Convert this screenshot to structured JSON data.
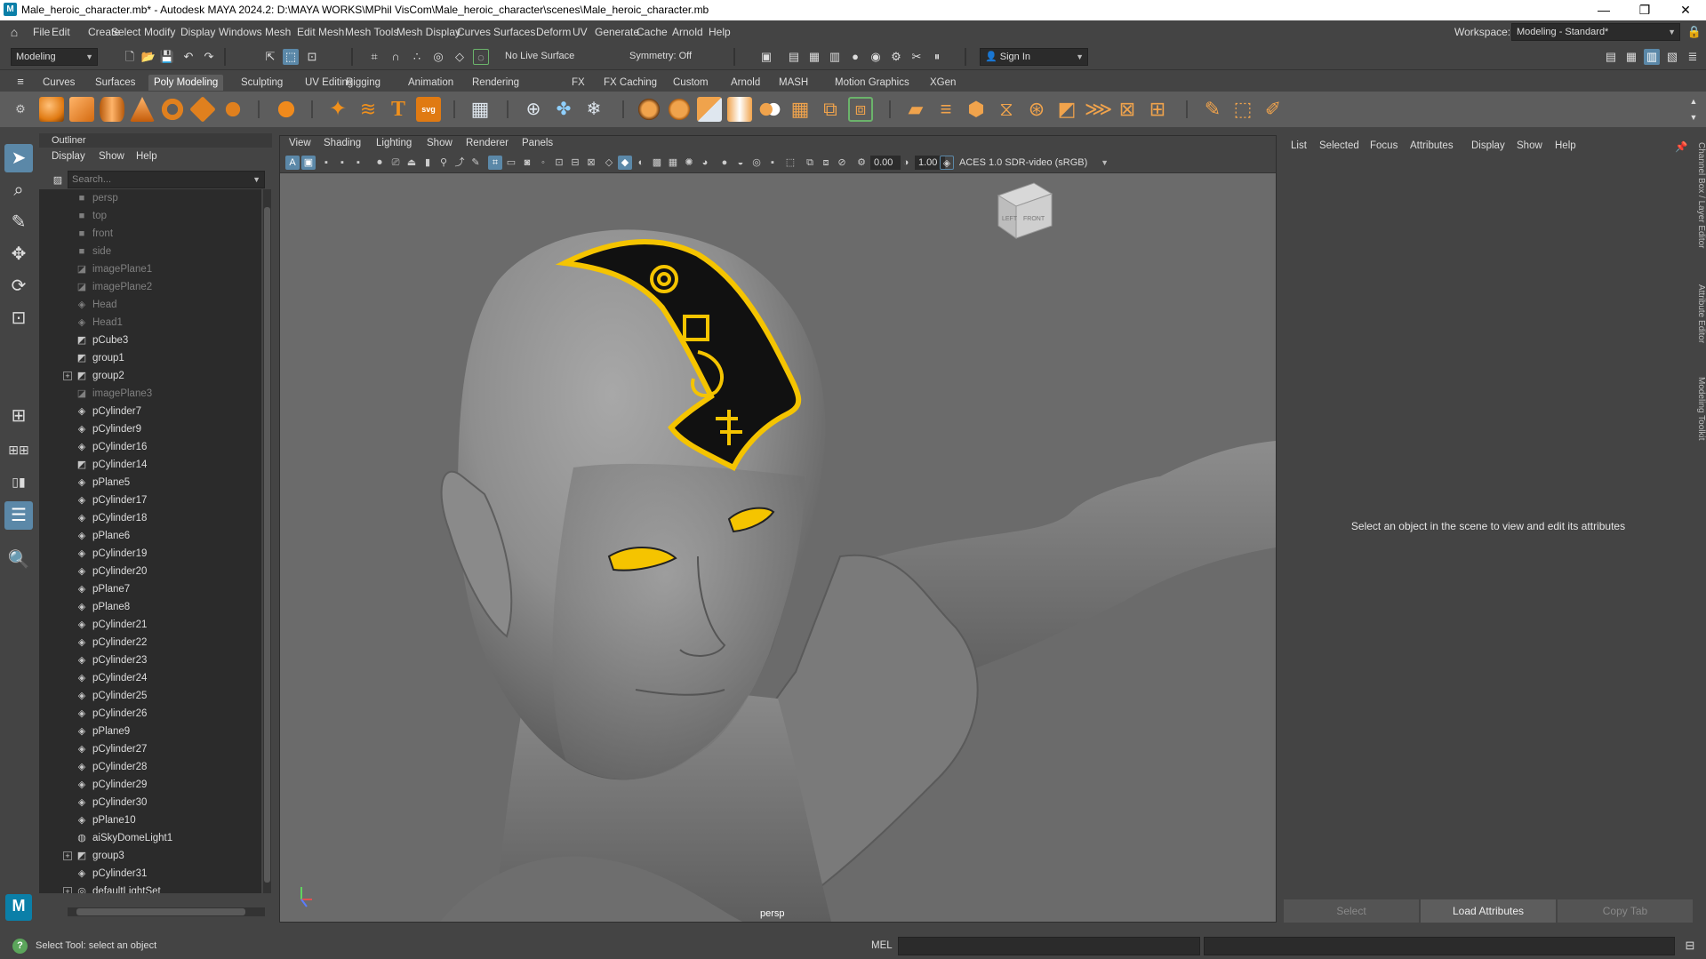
{
  "window": {
    "title": "Male_heroic_character.mb* - Autodesk MAYA 2024.2: D:\\MAYA WORKS\\MPhil VisCom\\Male_heroic_character\\scenes\\Male_heroic_character.mb",
    "app_icon": "M",
    "minimize": "—",
    "maximize": "❐",
    "close": "✕"
  },
  "menubar": {
    "items": [
      "File",
      "Edit",
      "Create",
      "Select",
      "Modify",
      "Display",
      "Windows",
      "Mesh",
      "Edit Mesh",
      "Mesh Tools",
      "Mesh Display",
      "Curves",
      "Surfaces",
      "Deform",
      "UV",
      "Generate",
      "Cache",
      "Arnold",
      "Help"
    ],
    "workspace_label": "Workspace:",
    "workspace_value": "Modeling - Standard*"
  },
  "statusline": {
    "mode": "Modeling",
    "live_surface": "No Live Surface",
    "symmetry": "Symmetry: Off",
    "sign_in": "Sign In"
  },
  "shelf": {
    "tabs": [
      "Curves",
      "Surfaces",
      "Poly Modeling",
      "Sculpting",
      "UV Editing",
      "Rigging",
      "Animation",
      "Rendering",
      "FX",
      "FX Caching",
      "Custom",
      "Arnold",
      "MASH",
      "Motion Graphics",
      "XGen"
    ],
    "active_tab": "Poly Modeling"
  },
  "outliner": {
    "title": "Outliner",
    "menu": [
      "Display",
      "Show",
      "Help"
    ],
    "search_placeholder": "Search...",
    "items": [
      {
        "label": "persp",
        "icon": "camera-icon",
        "dim": true
      },
      {
        "label": "top",
        "icon": "camera-icon",
        "dim": true
      },
      {
        "label": "front",
        "icon": "camera-icon",
        "dim": true
      },
      {
        "label": "side",
        "icon": "camera-icon",
        "dim": true
      },
      {
        "label": "imagePlane1",
        "icon": "image-plane-icon",
        "dim": true
      },
      {
        "label": "imagePlane2",
        "icon": "image-plane-icon",
        "dim": true
      },
      {
        "label": "Head",
        "icon": "mesh-icon",
        "dim": true
      },
      {
        "label": "Head1",
        "icon": "mesh-icon",
        "dim": true
      },
      {
        "label": "pCube3",
        "icon": "group-icon",
        "dim": false
      },
      {
        "label": "group1",
        "icon": "group-icon",
        "dim": false
      },
      {
        "label": "group2",
        "icon": "group-icon",
        "dim": false,
        "expandable": true
      },
      {
        "label": "imagePlane3",
        "icon": "image-plane-icon",
        "dim": true
      },
      {
        "label": "pCylinder7",
        "icon": "mesh-icon",
        "dim": false
      },
      {
        "label": "pCylinder9",
        "icon": "mesh-icon",
        "dim": false
      },
      {
        "label": "pCylinder16",
        "icon": "mesh-icon",
        "dim": false
      },
      {
        "label": "pCylinder14",
        "icon": "group-icon",
        "dim": false
      },
      {
        "label": "pPlane5",
        "icon": "mesh-icon",
        "dim": false
      },
      {
        "label": "pCylinder17",
        "icon": "mesh-icon",
        "dim": false
      },
      {
        "label": "pCylinder18",
        "icon": "mesh-icon",
        "dim": false
      },
      {
        "label": "pPlane6",
        "icon": "mesh-icon",
        "dim": false
      },
      {
        "label": "pCylinder19",
        "icon": "mesh-icon",
        "dim": false
      },
      {
        "label": "pCylinder20",
        "icon": "mesh-icon",
        "dim": false
      },
      {
        "label": "pPlane7",
        "icon": "mesh-icon",
        "dim": false
      },
      {
        "label": "pPlane8",
        "icon": "mesh-icon",
        "dim": false
      },
      {
        "label": "pCylinder21",
        "icon": "mesh-icon",
        "dim": false
      },
      {
        "label": "pCylinder22",
        "icon": "mesh-icon",
        "dim": false
      },
      {
        "label": "pCylinder23",
        "icon": "mesh-icon",
        "dim": false
      },
      {
        "label": "pCylinder24",
        "icon": "mesh-icon",
        "dim": false
      },
      {
        "label": "pCylinder25",
        "icon": "mesh-icon",
        "dim": false
      },
      {
        "label": "pCylinder26",
        "icon": "mesh-icon",
        "dim": false
      },
      {
        "label": "pPlane9",
        "icon": "mesh-icon",
        "dim": false
      },
      {
        "label": "pCylinder27",
        "icon": "mesh-icon",
        "dim": false
      },
      {
        "label": "pCylinder28",
        "icon": "mesh-icon",
        "dim": false
      },
      {
        "label": "pCylinder29",
        "icon": "mesh-icon",
        "dim": false
      },
      {
        "label": "pCylinder30",
        "icon": "mesh-icon",
        "dim": false
      },
      {
        "label": "pPlane10",
        "icon": "mesh-icon",
        "dim": false
      },
      {
        "label": "aiSkyDomeLight1",
        "icon": "light-icon",
        "dim": false
      },
      {
        "label": "group3",
        "icon": "group-icon",
        "dim": false,
        "expandable": true
      },
      {
        "label": "pCylinder31",
        "icon": "mesh-icon",
        "dim": false
      },
      {
        "label": "defaultLightSet",
        "icon": "set-icon",
        "dim": false,
        "expandable": true
      }
    ]
  },
  "viewport": {
    "menu": [
      "View",
      "Shading",
      "Lighting",
      "Show",
      "Renderer",
      "Panels"
    ],
    "near": "0.00",
    "far": "1.00",
    "color_space": "ACES 1.0 SDR-video (sRGB)",
    "camera": "persp",
    "viewcube_left": "LEFT",
    "viewcube_front": "FRONT",
    "accent": "#f5c400"
  },
  "attribute_editor": {
    "menu": [
      "List",
      "Selected",
      "Focus",
      "Attributes",
      "Display",
      "Show",
      "Help"
    ],
    "message": "Select an object in the scene to view and edit its attributes",
    "buttons": {
      "select": "Select",
      "load": "Load Attributes",
      "copy": "Copy Tab"
    }
  },
  "side_tabs": [
    "Channel Box / Layer Editor",
    "Attribute Editor",
    "Modeling Toolkit"
  ],
  "commandline": {
    "help": "Select Tool: select an object",
    "mel": "MEL"
  }
}
